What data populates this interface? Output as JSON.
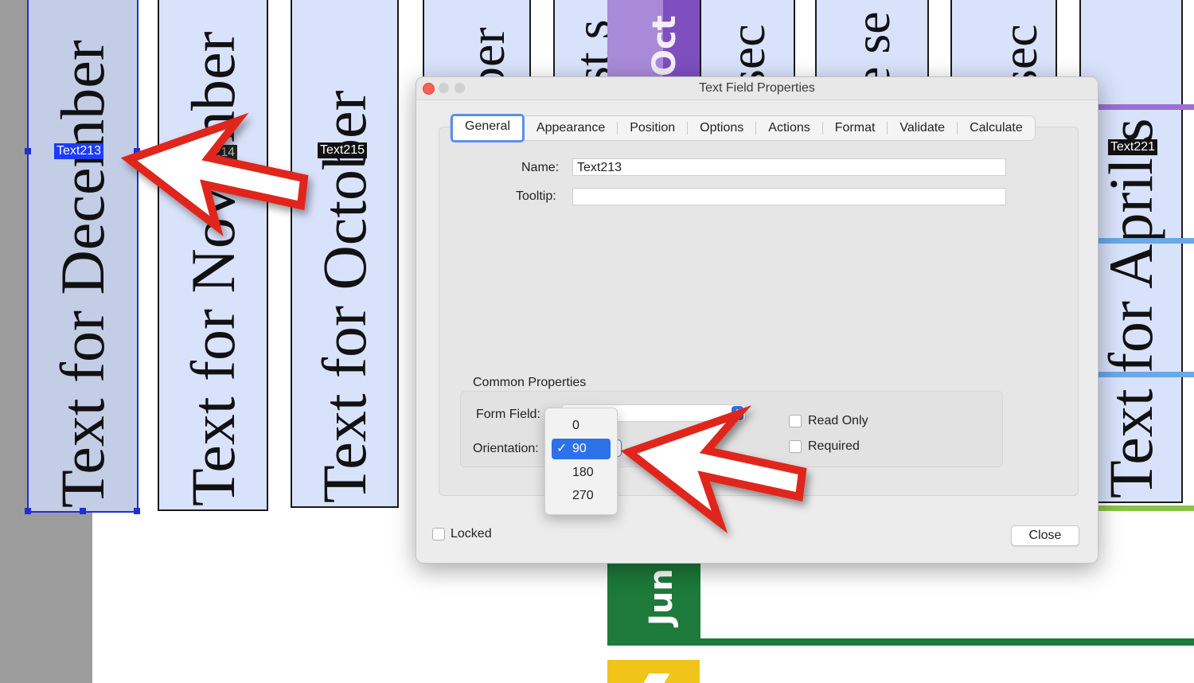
{
  "fields": [
    {
      "text": "Text for December",
      "tag": "Text213"
    },
    {
      "text": "Text for November",
      "tag": "Text214"
    },
    {
      "text": "Text for October",
      "tag": "Text215"
    },
    {
      "text": "ber",
      "tag": ""
    },
    {
      "text": "st s",
      "tag": ""
    },
    {
      "text": "sec",
      "tag": ""
    },
    {
      "text": "e se",
      "tag": ""
    },
    {
      "text": "sec",
      "tag": ""
    },
    {
      "text": "Text for April s",
      "tag": "Text221"
    }
  ],
  "bands": {
    "oct": "Oct",
    "jun": "Jun"
  },
  "colors": {
    "purple": "#7e57b8",
    "green": "#1d7a3a",
    "yellow": "#f0c419",
    "blue": "#6aa8e6",
    "lime": "#8bc34a",
    "arrow_red": "#e0261b"
  },
  "dialog": {
    "title": "Text Field Properties",
    "tabs": [
      "General",
      "Appearance",
      "Position",
      "Options",
      "Actions",
      "Format",
      "Validate",
      "Calculate"
    ],
    "name_label": "Name:",
    "name_value": "Text213",
    "tooltip_label": "Tooltip:",
    "tooltip_value": "",
    "common_title": "Common Properties",
    "form_field_label": "Form Field:",
    "orientation_label": "Orientation:",
    "read_only_label": "Read Only",
    "required_label": "Required",
    "locked_label": "Locked",
    "close_label": "Close"
  },
  "orientation_menu": {
    "options": [
      "0",
      "90",
      "180",
      "270"
    ],
    "selected": "90",
    "check": "✓"
  }
}
